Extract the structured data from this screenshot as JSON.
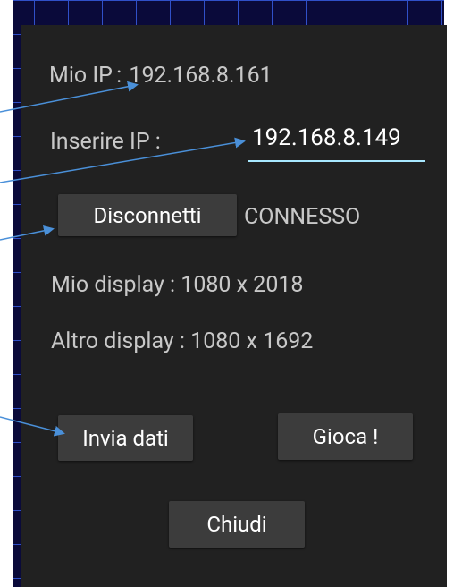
{
  "dialog": {
    "my_ip_label": "Mio IP",
    "my_ip_separator": ":",
    "my_ip_value": "192.168.8.161",
    "enter_ip_label": "Inserire IP :",
    "enter_ip_value": "192.168.8.149",
    "disconnect_button": "Disconnetti",
    "connection_status": "CONNESSO",
    "my_display": "Mio display : 1080 x 2018",
    "other_display": "Altro display : 1080 x 1692",
    "send_data_button": "Invia dati",
    "play_button": "Gioca !",
    "close_button": "Chiudi"
  },
  "colors": {
    "dialog_background": "#212121",
    "button_background": "#3c3c3c",
    "input_underline": "#a8e8ff",
    "arrow": "#4a90d9",
    "grid_lines": "#3050c8"
  },
  "annotations": {
    "arrow_count": 4
  }
}
